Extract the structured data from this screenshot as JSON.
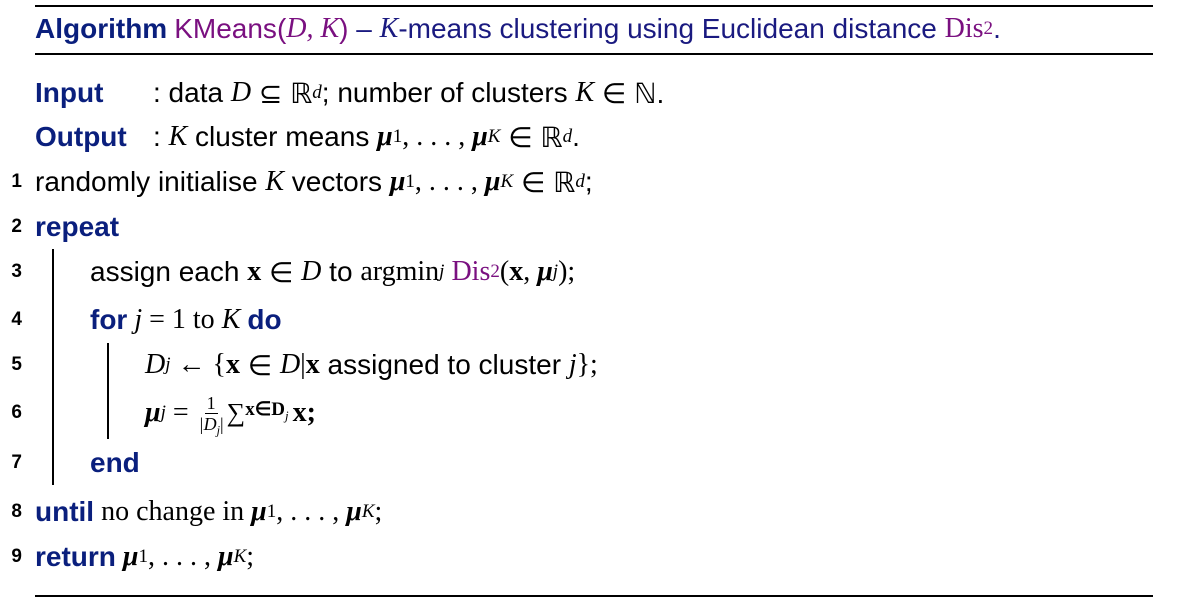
{
  "caption": {
    "label": "Algorithm",
    "name": "KMeans",
    "args": "D, K",
    "dash": " – ",
    "k_symbol": "K",
    "title_rest": "-means clustering using Euclidean distance ",
    "dis": "Dis",
    "dis_sub": "2",
    "period": "."
  },
  "io": {
    "input_label": "Input",
    "input_sep": ": data ",
    "input_D": "D",
    "input_subset": " ⊆ ℝ",
    "input_d": "d",
    "input_rest": "; number of clusters ",
    "input_K": "K",
    "input_in": " ∈ ℕ.",
    "output_label": "Output",
    "output_sep": ": ",
    "output_K": "K",
    "output_rest": " cluster means ",
    "output_mu1": "μ",
    "output_one": "1",
    "output_dots": ", . . . , ",
    "output_muK": "μ",
    "output_Ksub": "K",
    "output_in": " ∈ ℝ",
    "output_d": "d",
    "output_end": "."
  },
  "lines": {
    "l1_no": "1",
    "l1_text": "randomly initialise ",
    "l1_K": "K",
    "l1_vectors": " vectors ",
    "l1_mu": "μ",
    "l1_one": "1",
    "l1_dots": ", . . . , ",
    "l1_muK": "μ",
    "l1_Ksub": "K",
    "l1_in": " ∈ ℝ",
    "l1_d": "d",
    "l1_end": ";",
    "l2_no": "2",
    "l2_kw": "repeat",
    "l3_no": "3",
    "l3_text": "assign each ",
    "l3_x": "x",
    "l3_in": " ∈ ",
    "l3_D": "D",
    "l3_to": " to ",
    "l3_argmin": "argmin",
    "l3_j": "j",
    "l3_dis": "Dis",
    "l3_dis_sub": "2",
    "l3_open": "(",
    "l3_x2": "x",
    "l3_comma": ", ",
    "l3_mu": "μ",
    "l3_jsub": "j",
    "l3_close": ");",
    "l4_no": "4",
    "l4_for": "for",
    "l4_j": "j",
    "l4_eq": " = 1 to ",
    "l4_K": "K",
    "l4_do": "do",
    "l5_no": "5",
    "l5_D": "D",
    "l5_j": "j",
    "l5_arrow": " ← {",
    "l5_x": "x",
    "l5_in": " ∈ ",
    "l5_D2": "D",
    "l5_bar": "|",
    "l5_x2": "x",
    "l5_text": " assigned to cluster ",
    "l5_j2": "j",
    "l5_end": "};",
    "l6_no": "6",
    "l6_mu": "μ",
    "l6_j": "j",
    "l6_eq": " = ",
    "l6_num": "1",
    "l6_den": "|D",
    "l6_den_j": "j",
    "l6_den_end": "|",
    "l6_sum": "∑",
    "l6_sum_sub": "x∈D",
    "l6_sum_j": "j",
    "l6_x": "x",
    "l6_end": ";",
    "l7_no": "7",
    "l7_kw": "end",
    "l8_no": "8",
    "l8_kw": "until",
    "l8_text": " no change in ",
    "l8_mu": "μ",
    "l8_one": "1",
    "l8_dots": ", . . . , ",
    "l8_muK": "μ",
    "l8_Ksub": "K",
    "l8_end": ";",
    "l9_no": "9",
    "l9_kw": "return",
    "l9_mu": "μ",
    "l9_one": "1",
    "l9_dots": ", . . . , ",
    "l9_muK": "μ",
    "l9_Ksub": "K",
    "l9_end": ";"
  },
  "colors": {
    "keyword": "#0a1f7d",
    "caption_text": "#1a1a80",
    "function": "#7a1080"
  }
}
